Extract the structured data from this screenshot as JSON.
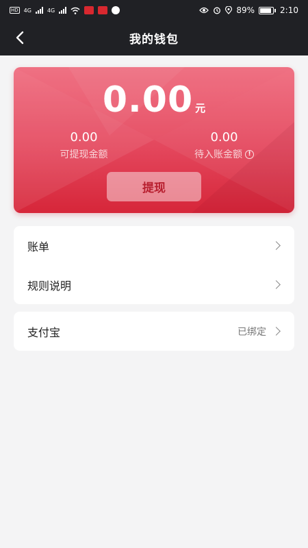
{
  "status_bar": {
    "net_1": "4G",
    "net_2": "4G",
    "battery": "89%",
    "time": "2:10"
  },
  "header": {
    "title": "我的钱包",
    "back_icon": "chevron-left-icon"
  },
  "wallet_card": {
    "balance": "0.00",
    "unit": "元",
    "withdrawable_value": "0.00",
    "withdrawable_label": "可提现金额",
    "pending_value": "0.00",
    "pending_label": "待入账金额",
    "info_icon_glyph": "!",
    "withdraw_label": "提现",
    "gradient_colors": [
      "#ef6a7d",
      "#e4475d",
      "#d62639"
    ]
  },
  "menu": {
    "bill_label": "账单",
    "rules_label": "规则说明",
    "alipay_label": "支付宝",
    "alipay_status": "已绑定"
  },
  "colors": {
    "header_bg": "#202125",
    "page_bg": "#f4f4f5",
    "accent": "#e4475d"
  }
}
